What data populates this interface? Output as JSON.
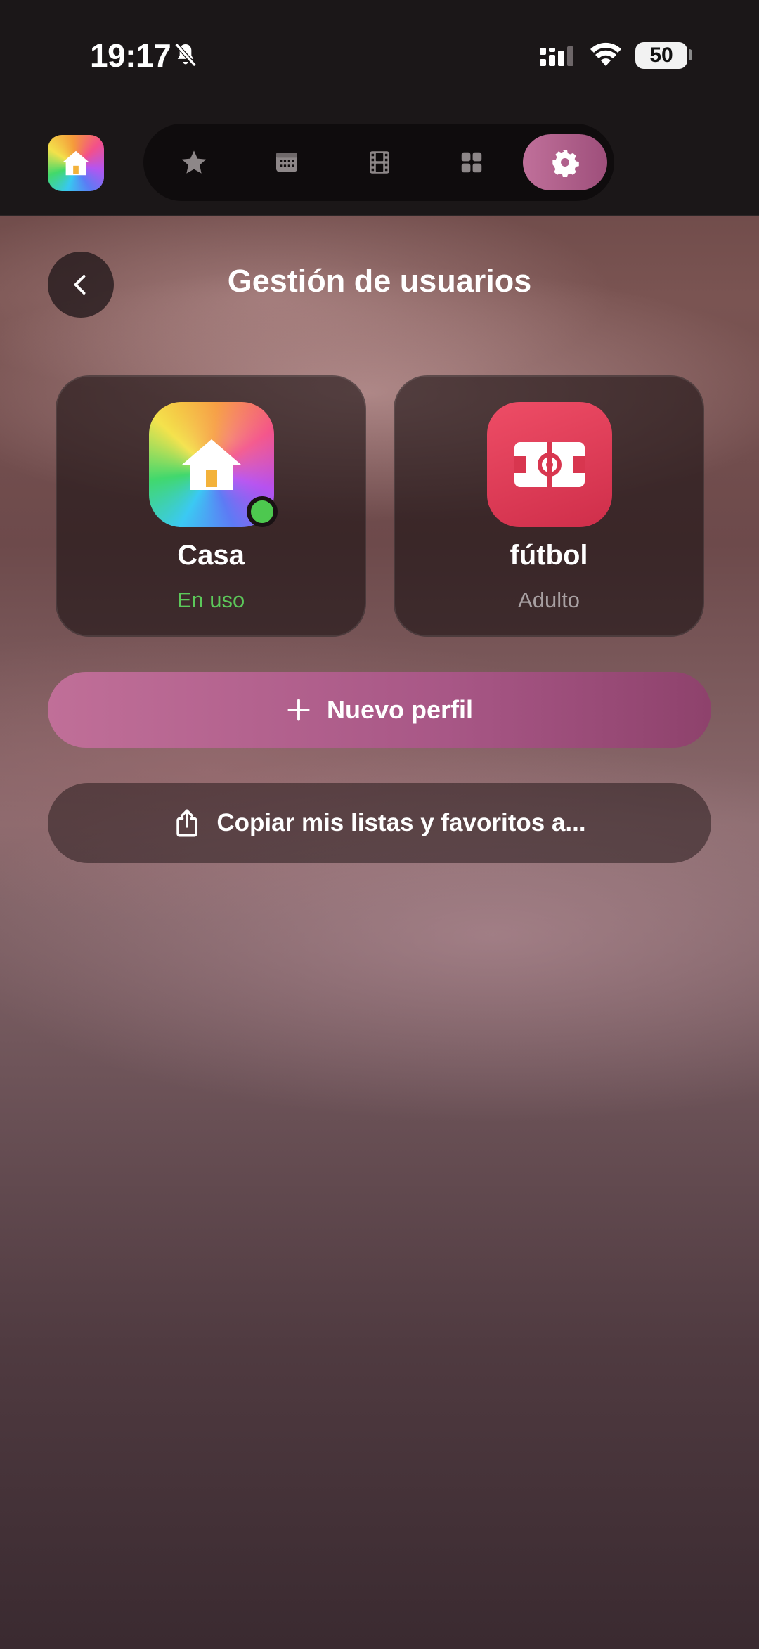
{
  "status_bar": {
    "time": "19:17",
    "battery": "50",
    "icons": [
      "bell-slash-icon",
      "cellular-signal-icon",
      "wifi-icon",
      "battery-icon"
    ]
  },
  "nav": {
    "logo_icon": "home-icon",
    "items": [
      {
        "icon": "star-icon",
        "active": false
      },
      {
        "icon": "calendar-icon",
        "active": false
      },
      {
        "icon": "film-icon",
        "active": false
      },
      {
        "icon": "grid-icon",
        "active": false
      },
      {
        "icon": "gear-icon",
        "active": true
      }
    ],
    "accent": "#b0608c"
  },
  "page": {
    "title": "Gestión de usuarios",
    "back_icon": "chevron-left-icon"
  },
  "profiles": [
    {
      "name": "Casa",
      "status": "En uso",
      "status_color": "#5cc85a",
      "icon": "home-icon",
      "online": true
    },
    {
      "name": "fútbol",
      "status": "Adulto",
      "status_color": "#a8a0a2",
      "icon": "soccer-field-icon",
      "online": false
    }
  ],
  "actions": {
    "new_profile": "Nuevo perfil",
    "copy_lists": "Copiar mis listas y favoritos a..."
  }
}
